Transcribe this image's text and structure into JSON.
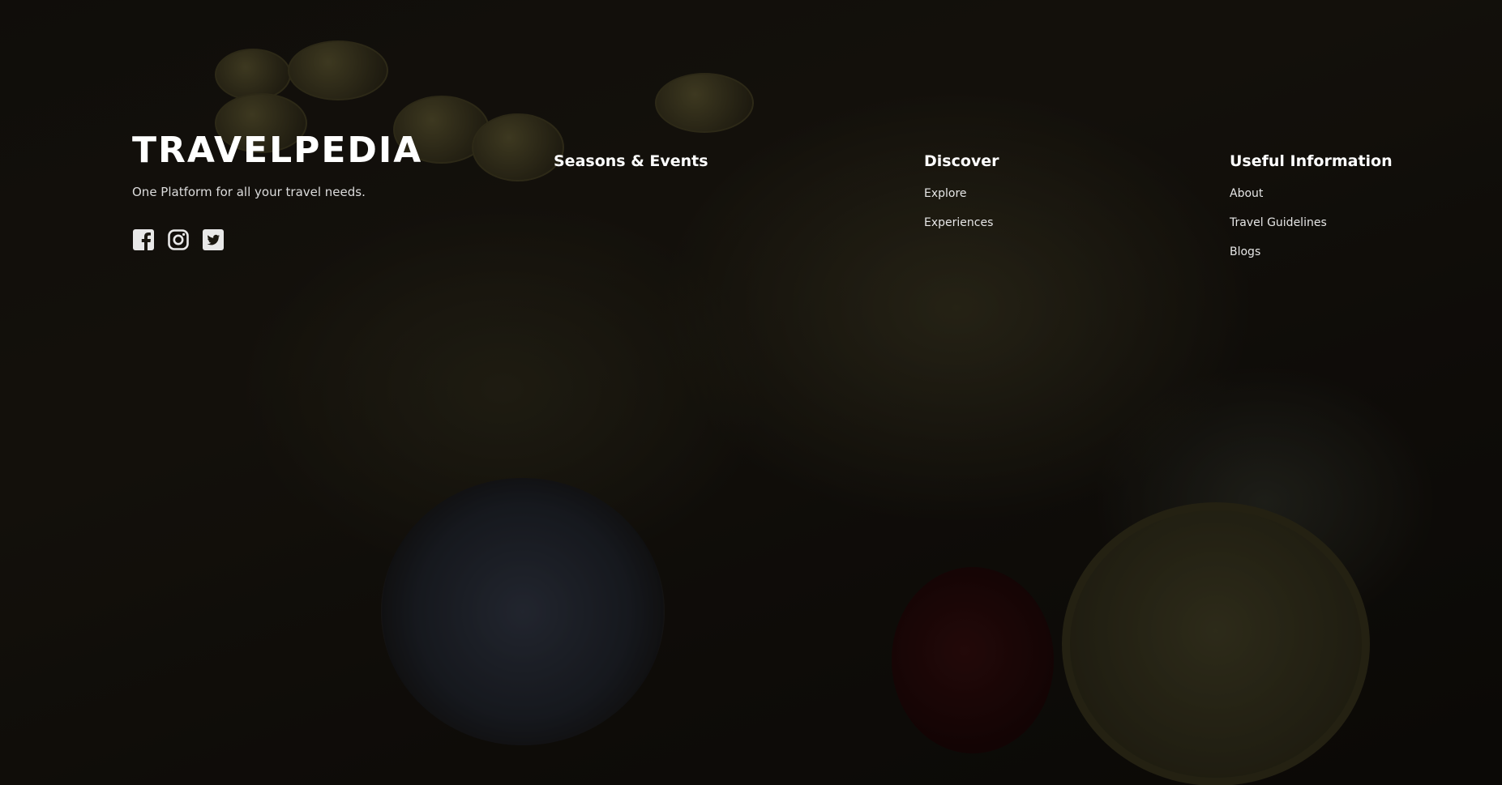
{
  "brand": {
    "title": "TRAVELPEDIA",
    "tagline": "One Platform for all your travel needs."
  },
  "social": [
    {
      "icon": "facebook-icon",
      "label": "Facebook"
    },
    {
      "icon": "instagram-icon",
      "label": "Instagram"
    },
    {
      "icon": "twitter-icon",
      "label": "Twitter"
    }
  ],
  "columns": {
    "seasons": {
      "title": "Seasons & Events",
      "links": []
    },
    "discover": {
      "title": "Discover",
      "links": [
        "Explore",
        "Experiences"
      ]
    },
    "useful": {
      "title": "Useful Information",
      "links": [
        "About",
        "Travel Guidelines",
        "Blogs"
      ]
    }
  },
  "colors": {
    "text": "#ffffff",
    "overlay": "#000000",
    "icon": "#e8e8e8"
  }
}
